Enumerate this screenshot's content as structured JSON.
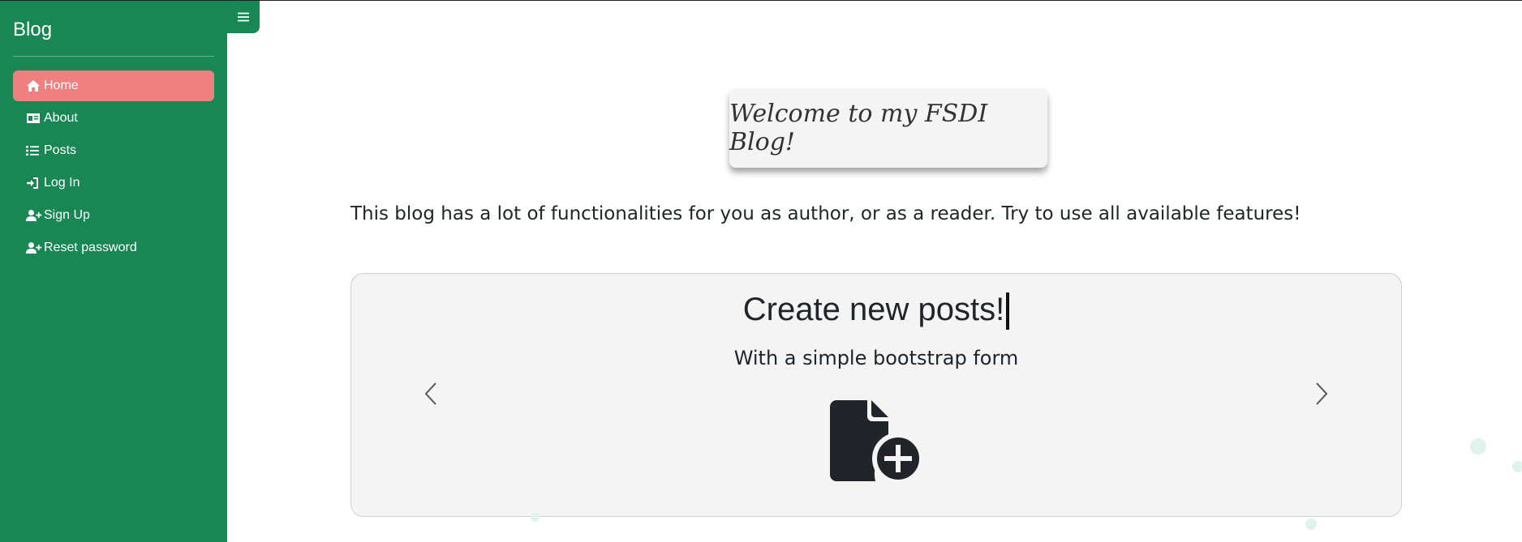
{
  "sidebar": {
    "brand": "Blog",
    "items": [
      {
        "label": "Home",
        "icon": "home-icon",
        "active": true
      },
      {
        "label": "About",
        "icon": "id-card-icon"
      },
      {
        "label": "Posts",
        "icon": "list-icon"
      },
      {
        "label": "Log In",
        "icon": "login-icon"
      },
      {
        "label": "Sign Up",
        "icon": "user-plus-icon"
      },
      {
        "label": "Reset password",
        "icon": "user-plus-icon"
      }
    ]
  },
  "toggle": {
    "icon": "hamburger-icon"
  },
  "welcome": {
    "title": "Welcome to my FSDI Blog!"
  },
  "intro": {
    "text": "This blog has a lot of functionalities for you as author, or as a reader. Try to use all available features!"
  },
  "carousel": {
    "title": "Create new posts!",
    "subtitle": "With a simple bootstrap form",
    "icon": "file-plus-icon",
    "prev_icon": "chevron-left-icon",
    "next_icon": "chevron-right-icon"
  },
  "colors": {
    "sidebar_bg": "#198754",
    "active_item": "#f08080",
    "card_bg": "#f4f4f4"
  }
}
